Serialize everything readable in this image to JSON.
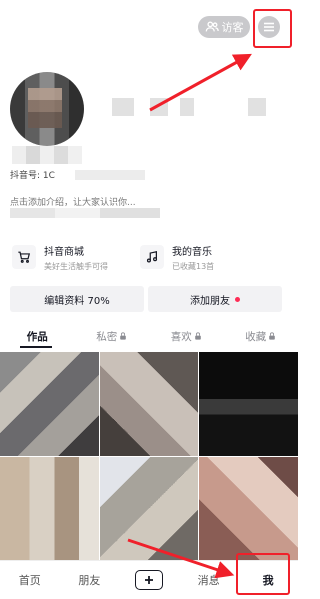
{
  "header": {
    "visitor_label": "访客",
    "douyin_id_label": "抖音号: 1C",
    "bio_text": "点击添加介绍，让大家认识你..."
  },
  "shortcuts": [
    {
      "title": "抖音商城",
      "subtitle": "美好生活触手可得",
      "icon": "cart-icon"
    },
    {
      "title": "我的音乐",
      "subtitle": "已收藏13首",
      "icon": "music-icon"
    }
  ],
  "actions": {
    "edit_profile": "编辑资料 70%",
    "add_friend": "添加朋友"
  },
  "tabs": [
    {
      "label": "作品",
      "locked": false
    },
    {
      "label": "私密",
      "locked": true
    },
    {
      "label": "喜欢",
      "locked": true
    },
    {
      "label": "收藏",
      "locked": true
    }
  ],
  "bottom_nav": {
    "home": "首页",
    "friends": "朋友",
    "messages": "消息",
    "me": "我"
  },
  "colors": {
    "accent_red": "#fe2c55",
    "annotation_red": "#f0202a"
  }
}
